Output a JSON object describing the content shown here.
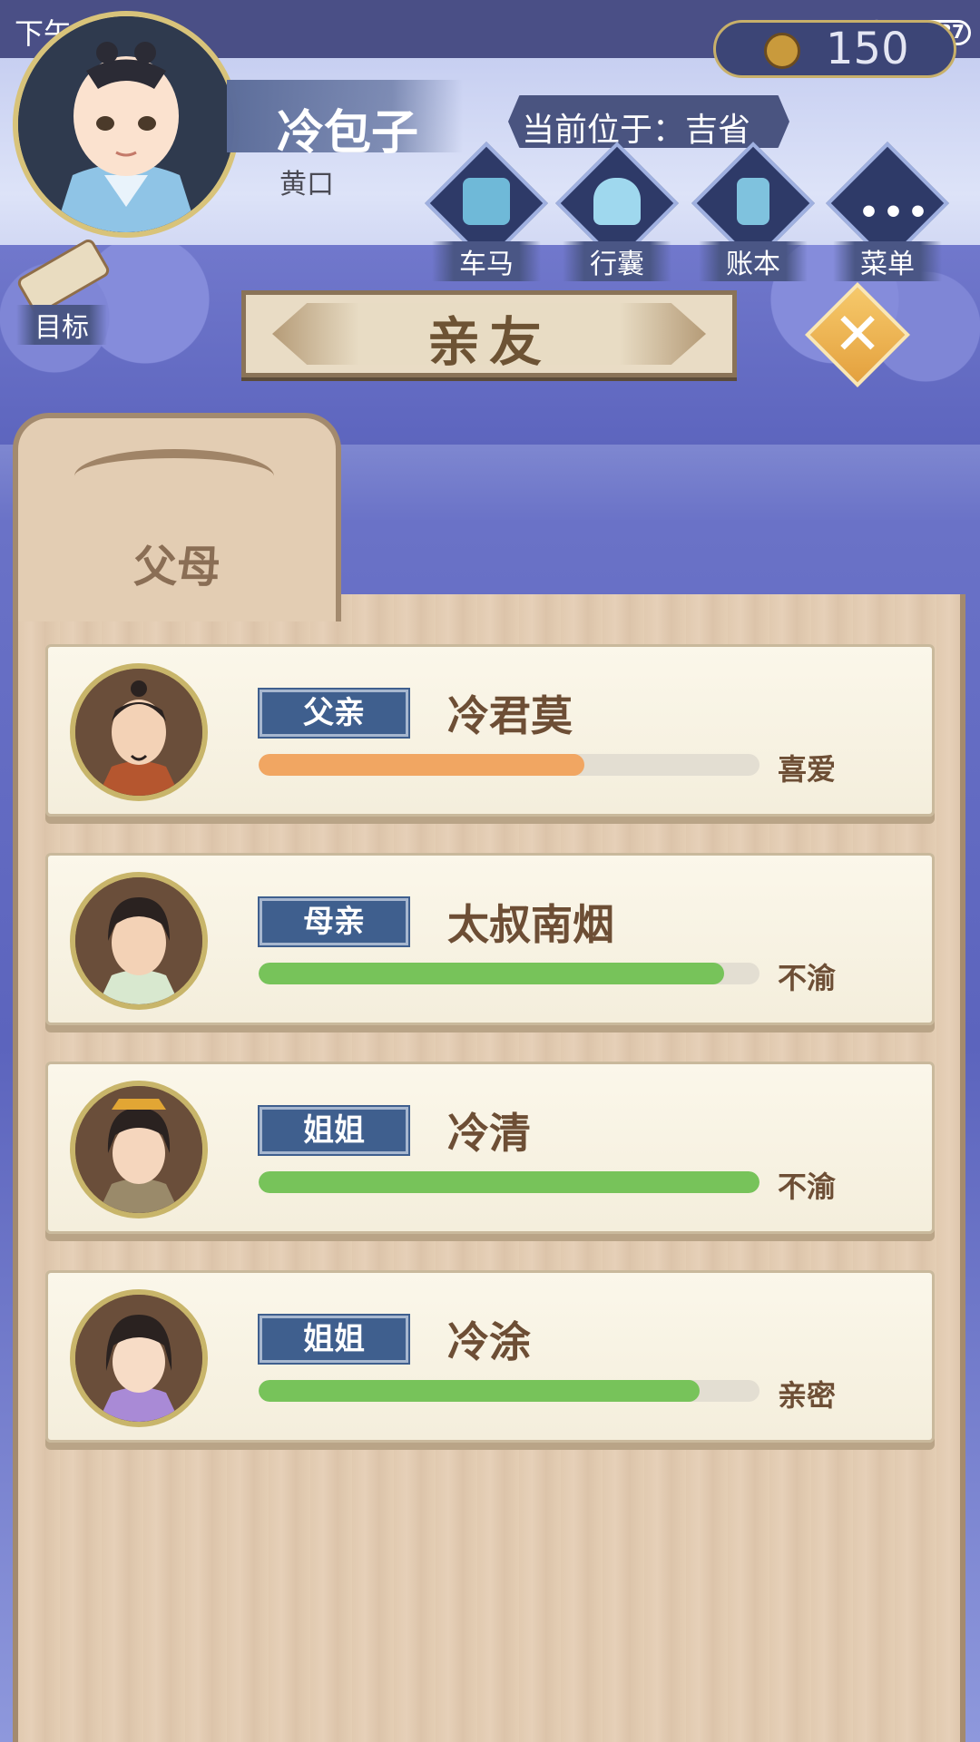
{
  "status_bar": {
    "time": "下午2:11",
    "battery": "37"
  },
  "player": {
    "name": "冷包子",
    "title": "黄口",
    "location": "当前位于：吉省",
    "coins": "150"
  },
  "nav": [
    {
      "label": "车马",
      "icon": "carriage-icon"
    },
    {
      "label": "行囊",
      "icon": "bag-icon"
    },
    {
      "label": "账本",
      "icon": "ledger-icon"
    },
    {
      "label": "菜单",
      "icon": "menu-icon"
    }
  ],
  "goal": {
    "label": "目标"
  },
  "dialog": {
    "title": "亲友",
    "tab": "父母"
  },
  "colors": {
    "orange_bar": "#f1a662",
    "green_bar": "#77c35a",
    "badge_blue": "#3f5f8e"
  },
  "relatives": [
    {
      "relation": "父亲",
      "name": "冷君莫",
      "mood": "喜爱",
      "affinity": 0.65,
      "bar_color": "#f1a662"
    },
    {
      "relation": "母亲",
      "name": "太叔南烟",
      "mood": "不渝",
      "affinity": 0.93,
      "bar_color": "#77c35a"
    },
    {
      "relation": "姐姐",
      "name": "冷清",
      "mood": "不渝",
      "affinity": 1.0,
      "bar_color": "#77c35a"
    },
    {
      "relation": "姐姐",
      "name": "冷涂",
      "mood": "亲密",
      "affinity": 0.88,
      "bar_color": "#77c35a"
    }
  ]
}
